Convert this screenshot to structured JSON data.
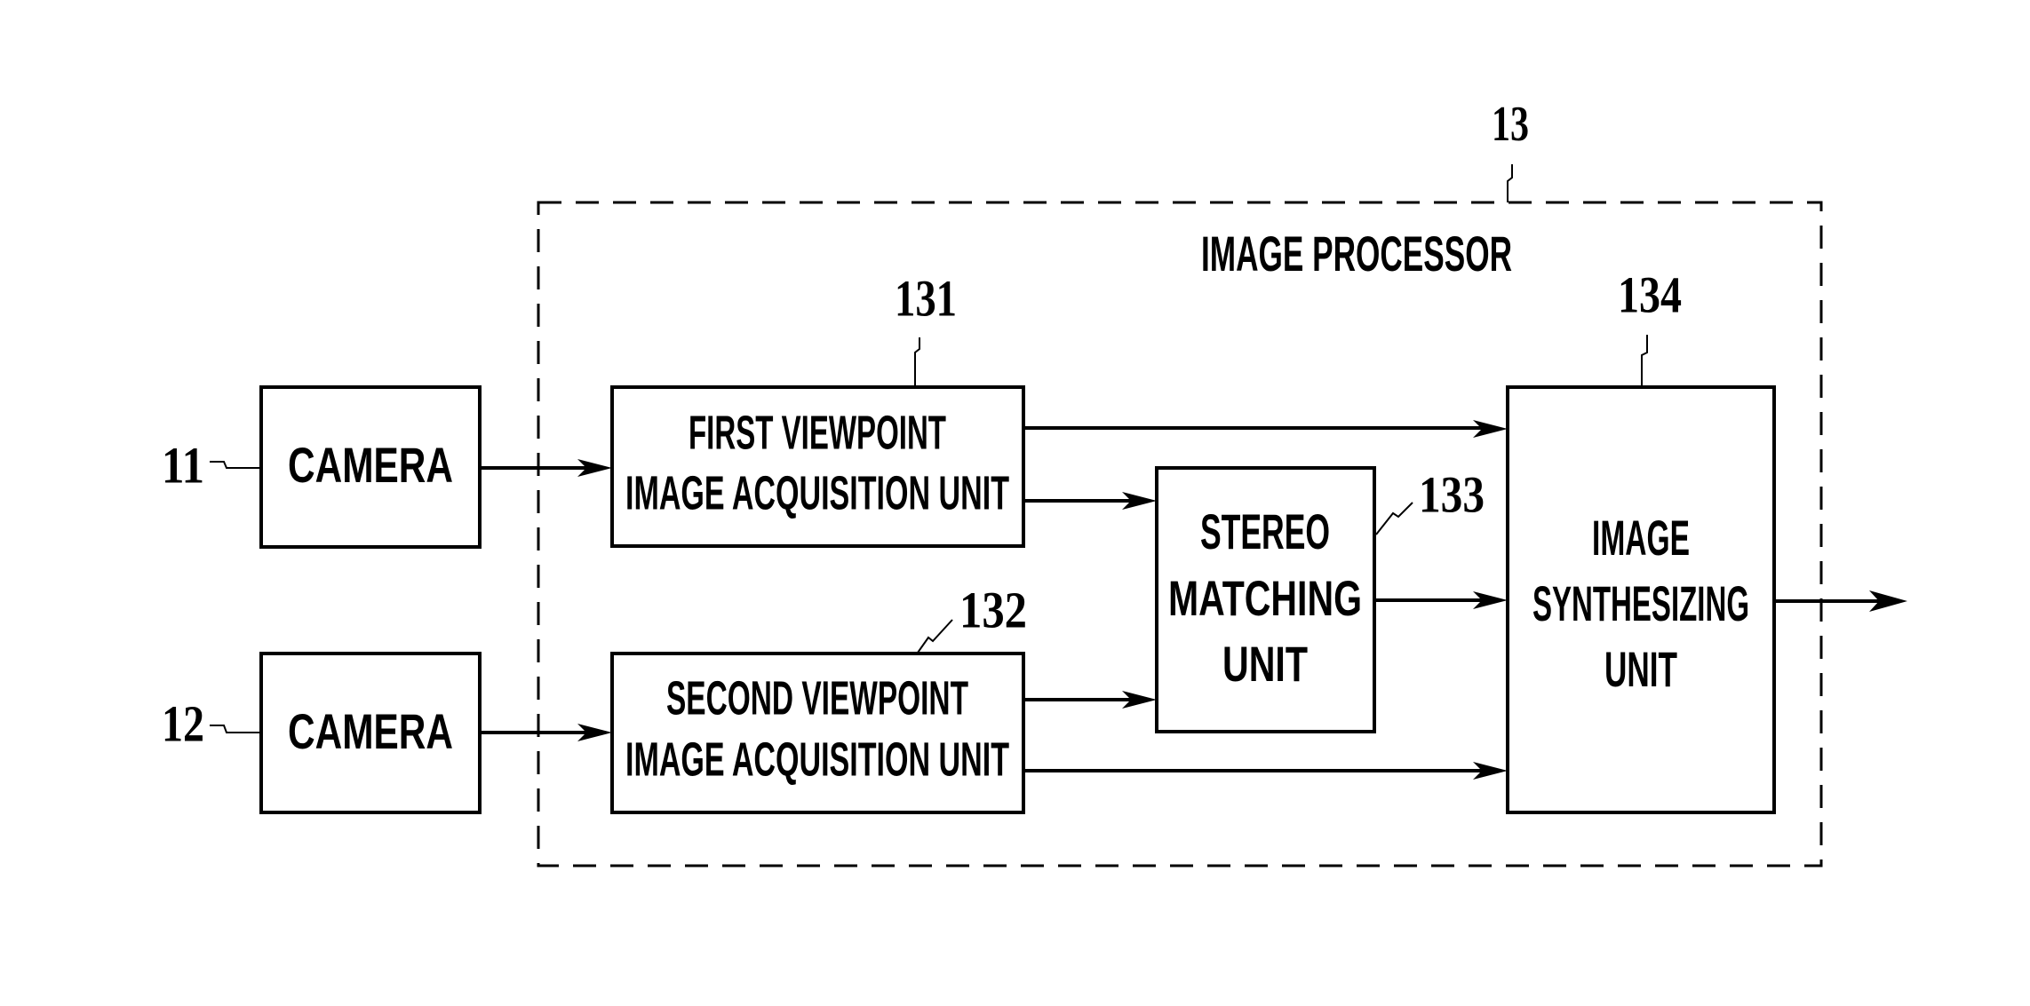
{
  "diagram": {
    "processor": {
      "ref": "13",
      "title": "IMAGE PROCESSOR"
    },
    "cameras": [
      {
        "ref": "11",
        "label": "CAMERA"
      },
      {
        "ref": "12",
        "label": "CAMERA"
      }
    ],
    "units": {
      "first": {
        "ref": "131",
        "lines": [
          "FIRST VIEWPOINT",
          "IMAGE ACQUISITION UNIT"
        ]
      },
      "second": {
        "ref": "132",
        "lines": [
          "SECOND VIEWPOINT",
          "IMAGE ACQUISITION UNIT"
        ]
      },
      "stereo": {
        "ref": "133",
        "lines": [
          "STEREO",
          "MATCHING",
          "UNIT"
        ]
      },
      "synth": {
        "ref": "134",
        "lines": [
          "IMAGE",
          "SYNTHESIZING",
          "UNIT"
        ]
      }
    },
    "connections": [
      {
        "from": "camera-11",
        "to": "first-viewpoint-unit"
      },
      {
        "from": "camera-12",
        "to": "second-viewpoint-unit"
      },
      {
        "from": "first-viewpoint-unit",
        "to": "image-synthesizing-unit"
      },
      {
        "from": "first-viewpoint-unit",
        "to": "stereo-matching-unit"
      },
      {
        "from": "second-viewpoint-unit",
        "to": "stereo-matching-unit"
      },
      {
        "from": "second-viewpoint-unit",
        "to": "image-synthesizing-unit"
      },
      {
        "from": "stereo-matching-unit",
        "to": "image-synthesizing-unit"
      },
      {
        "from": "image-synthesizing-unit",
        "to": "output"
      }
    ]
  }
}
